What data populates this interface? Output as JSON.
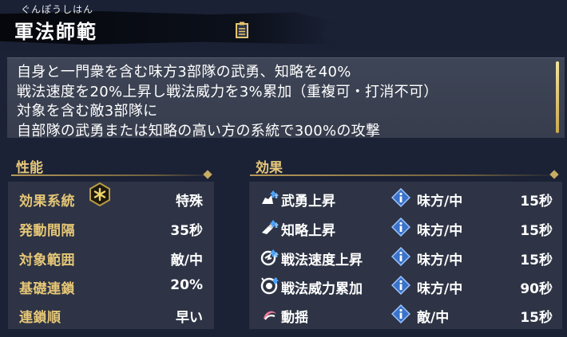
{
  "header": {
    "furigana": "ぐんぽうしはん",
    "title": "軍法師範",
    "doc_icon": "document-icon"
  },
  "description": {
    "lines": [
      "自身と一門衆を含む味方3部隊の武勇、知略を40%",
      "戦法速度を20%上昇し戦法威力を3%累加（重複可・打消不可）",
      "対象を含む敵3部隊に",
      "自部隊の武勇または知略の高い方の系統で300%の攻撃"
    ]
  },
  "performance": {
    "heading": "性能",
    "rows": [
      {
        "label": "効果系統",
        "value": "特殊",
        "icon": "snowflake-seal-icon"
      },
      {
        "label": "発動間隔",
        "value": "35秒"
      },
      {
        "label": "対象範囲",
        "value": "敵/中"
      },
      {
        "label": "基礎連鎖",
        "value": "20%"
      },
      {
        "label": "連鎖順",
        "value": "早い"
      }
    ]
  },
  "effects": {
    "heading": "効果",
    "rows": [
      {
        "name": "武勇上昇",
        "target": "味方/中",
        "duration": "15秒",
        "icon": "valor-up-icon"
      },
      {
        "name": "知略上昇",
        "target": "味方/中",
        "duration": "15秒",
        "icon": "intellect-up-icon"
      },
      {
        "name": "戦法速度上昇",
        "target": "味方/中",
        "duration": "15秒",
        "icon": "tactic-speed-up-icon"
      },
      {
        "name": "戦法威力累加",
        "target": "味方/中",
        "duration": "90秒",
        "icon": "tactic-power-stack-icon"
      },
      {
        "name": "動揺",
        "target": "敵/中",
        "duration": "15秒",
        "icon": "agitation-icon"
      }
    ]
  },
  "colors": {
    "accent_gold": "#e6c777",
    "background": "#1b2236",
    "panel": "#2e3445",
    "info_blue": "#5a8fe0"
  }
}
